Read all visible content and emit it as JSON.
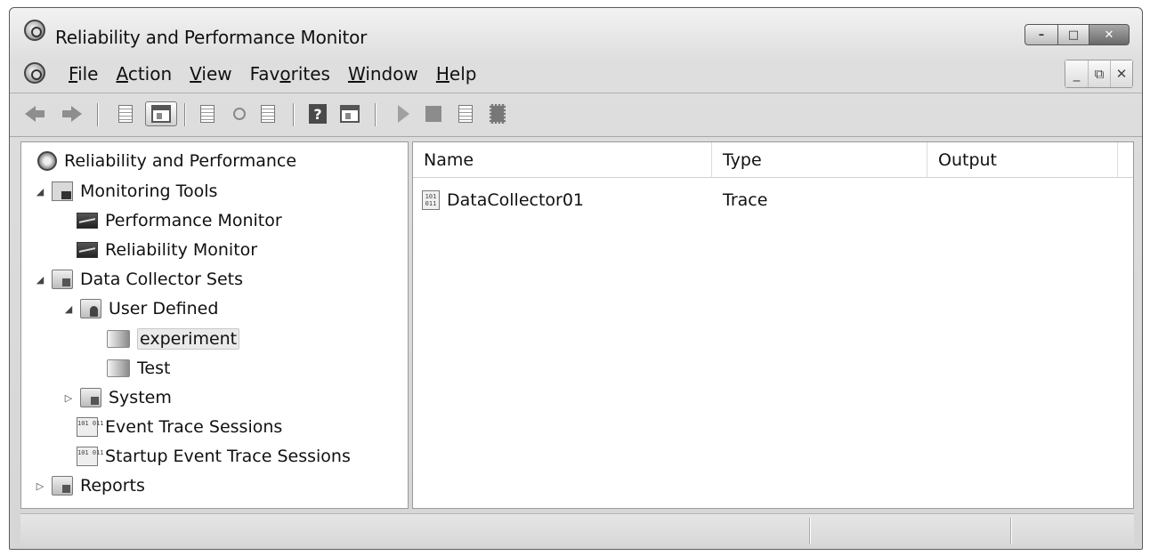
{
  "window": {
    "title": "Reliability and Performance Monitor",
    "controls": {
      "minimize": "–",
      "maximize": "□",
      "close": "✕"
    }
  },
  "menubar": {
    "items": [
      {
        "label": "File",
        "mnemonic": "F"
      },
      {
        "label": "Action",
        "mnemonic": "A"
      },
      {
        "label": "View",
        "mnemonic": "V"
      },
      {
        "label": "Favorites",
        "mnemonic": "o"
      },
      {
        "label": "Window",
        "mnemonic": "W"
      },
      {
        "label": "Help",
        "mnemonic": "H"
      }
    ],
    "child_controls": {
      "minimize": "_",
      "restore": "⧉",
      "close": "✕"
    }
  },
  "toolbar": {
    "buttons": [
      "back-icon",
      "forward-icon",
      "up-icon",
      "show-hide-console-tree-icon",
      "properties-icon",
      "refresh-icon",
      "export-list-icon",
      "help-icon",
      "show-hide-action-pane-icon",
      "start-icon",
      "stop-icon",
      "task-icon",
      "latest-report-icon"
    ],
    "help_glyph": "?"
  },
  "tree": {
    "nodes": [
      {
        "label": "Reliability and Performance",
        "icon": "gear-icon",
        "expander": "",
        "selected": false
      },
      {
        "label": "Monitoring Tools",
        "icon": "monitoring-tools-icon",
        "expander": "◢",
        "selected": false
      },
      {
        "label": "Performance Monitor",
        "icon": "performance-monitor-icon",
        "expander": "",
        "selected": false
      },
      {
        "label": "Reliability Monitor",
        "icon": "reliability-monitor-icon",
        "expander": "",
        "selected": false
      },
      {
        "label": "Data Collector Sets",
        "icon": "data-collector-sets-icon",
        "expander": "◢",
        "selected": false
      },
      {
        "label": "User Defined",
        "icon": "user-defined-icon",
        "expander": "◢",
        "selected": false
      },
      {
        "label": "experiment",
        "icon": "collector-set-icon",
        "expander": "",
        "selected": true
      },
      {
        "label": "Test",
        "icon": "collector-set-icon",
        "expander": "",
        "selected": false
      },
      {
        "label": "System",
        "icon": "system-folder-icon",
        "expander": "▷",
        "selected": false
      },
      {
        "label": "Event Trace Sessions",
        "icon": "trace-session-icon",
        "expander": "",
        "selected": false
      },
      {
        "label": "Startup Event Trace Sessions",
        "icon": "trace-session-icon",
        "expander": "",
        "selected": false
      },
      {
        "label": "Reports",
        "icon": "reports-icon",
        "expander": "▷",
        "selected": false
      }
    ]
  },
  "list": {
    "columns": [
      "Name",
      "Type",
      "Output"
    ],
    "rows": [
      {
        "name": "DataCollector01",
        "type": "Trace",
        "output": "",
        "icon": "trace-file-icon"
      }
    ],
    "icon_text": "101\n011"
  },
  "statusbar": {
    "text": ""
  }
}
